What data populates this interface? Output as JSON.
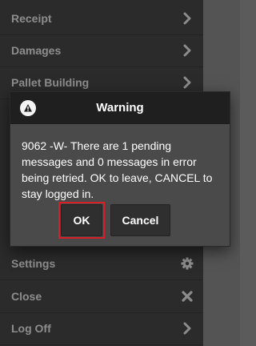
{
  "menu": {
    "items": [
      {
        "label": "Receipt",
        "icon": "chevron-right-icon"
      },
      {
        "label": "Damages",
        "icon": "chevron-right-icon"
      },
      {
        "label": "Pallet Building",
        "icon": "chevron-right-icon"
      },
      {
        "label": "Settings",
        "icon": "gear-icon"
      },
      {
        "label": "Close",
        "icon": "close-icon"
      },
      {
        "label": "Log Off",
        "icon": "chevron-right-icon"
      }
    ]
  },
  "status": {
    "icon": "status-indicator-icon",
    "color": "#7fd36e"
  },
  "dialog": {
    "title": "Warning",
    "icon": "warning-icon",
    "message": "9062 -W- There are 1 pending messages and 0 messages in error being retried. OK to leave, CANCEL to stay logged in.",
    "ok_label": "OK",
    "cancel_label": "Cancel"
  },
  "colors": {
    "focus_ring": "#d61f26",
    "dialog_header": "#1f1f1f",
    "menu_bg": "#4f4f4f"
  }
}
